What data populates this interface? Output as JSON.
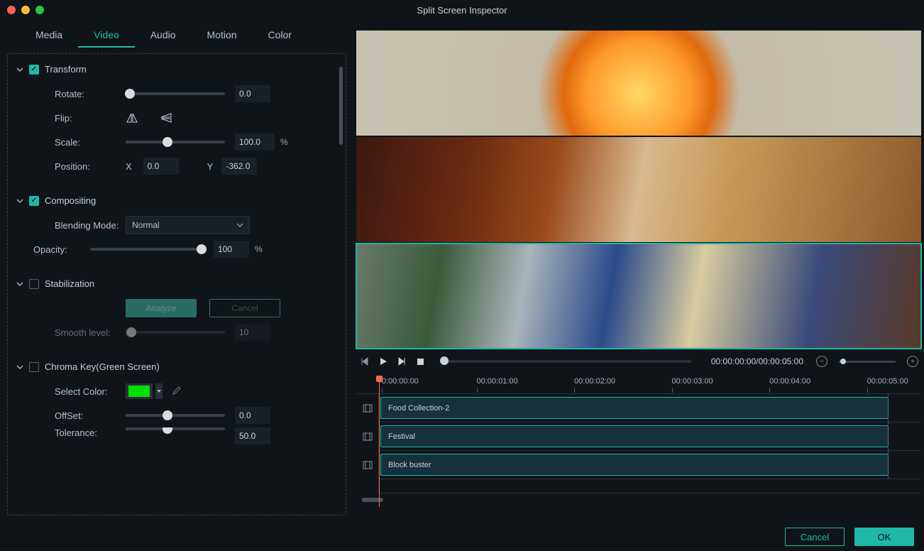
{
  "window": {
    "title": "Split Screen Inspector"
  },
  "tabs": {
    "items": [
      "Media",
      "Video",
      "Audio",
      "Motion",
      "Color"
    ],
    "active": 1
  },
  "sections": {
    "transform": {
      "title": "Transform",
      "checked": true,
      "rotate": {
        "label": "Rotate:",
        "value": "0.0",
        "sliderPos": 0
      },
      "flip": {
        "label": "Flip:"
      },
      "scale": {
        "label": "Scale:",
        "value": "100.0",
        "suffix": "%",
        "sliderPos": 42
      },
      "position": {
        "label": "Position:",
        "xLabel": "X",
        "x": "0.0",
        "yLabel": "Y",
        "y": "-362.0"
      }
    },
    "compositing": {
      "title": "Compositing",
      "checked": true,
      "blending": {
        "label": "Blending Mode:",
        "value": "Normal"
      },
      "opacity": {
        "label": "Opacity:",
        "value": "100",
        "suffix": "%",
        "sliderPos": 100
      }
    },
    "stabilization": {
      "title": "Stabilization",
      "checked": false,
      "analyze": "Analyze",
      "cancel": "Cancel",
      "smooth": {
        "label": "Smooth level:",
        "value": "10",
        "sliderPos": 6
      }
    },
    "chromakey": {
      "title": "Chroma Key(Green Screen)",
      "checked": false,
      "selectColor": {
        "label": "Select Color:",
        "value": "#00e000"
      },
      "offset": {
        "label": "OffSet:",
        "value": "0.0",
        "sliderPos": 42
      },
      "tolerance": {
        "label": "Tolerance:",
        "value": "50.0",
        "sliderPos": 42
      }
    }
  },
  "playback": {
    "timecode": "00:00:00:00/00:00:05:00"
  },
  "timeline": {
    "marks": [
      "0:00:00:00",
      "00:00:01:00",
      "00:00:02:00",
      "00:00:03:00",
      "00:00:04:00",
      "00:00:05:00"
    ],
    "tracks": [
      {
        "clip": "Food Collection-2"
      },
      {
        "clip": "Festival"
      },
      {
        "clip": "Block buster"
      }
    ]
  },
  "footer": {
    "cancel": "Cancel",
    "ok": "OK"
  },
  "colors": {
    "accent": "#1fb8a8"
  }
}
